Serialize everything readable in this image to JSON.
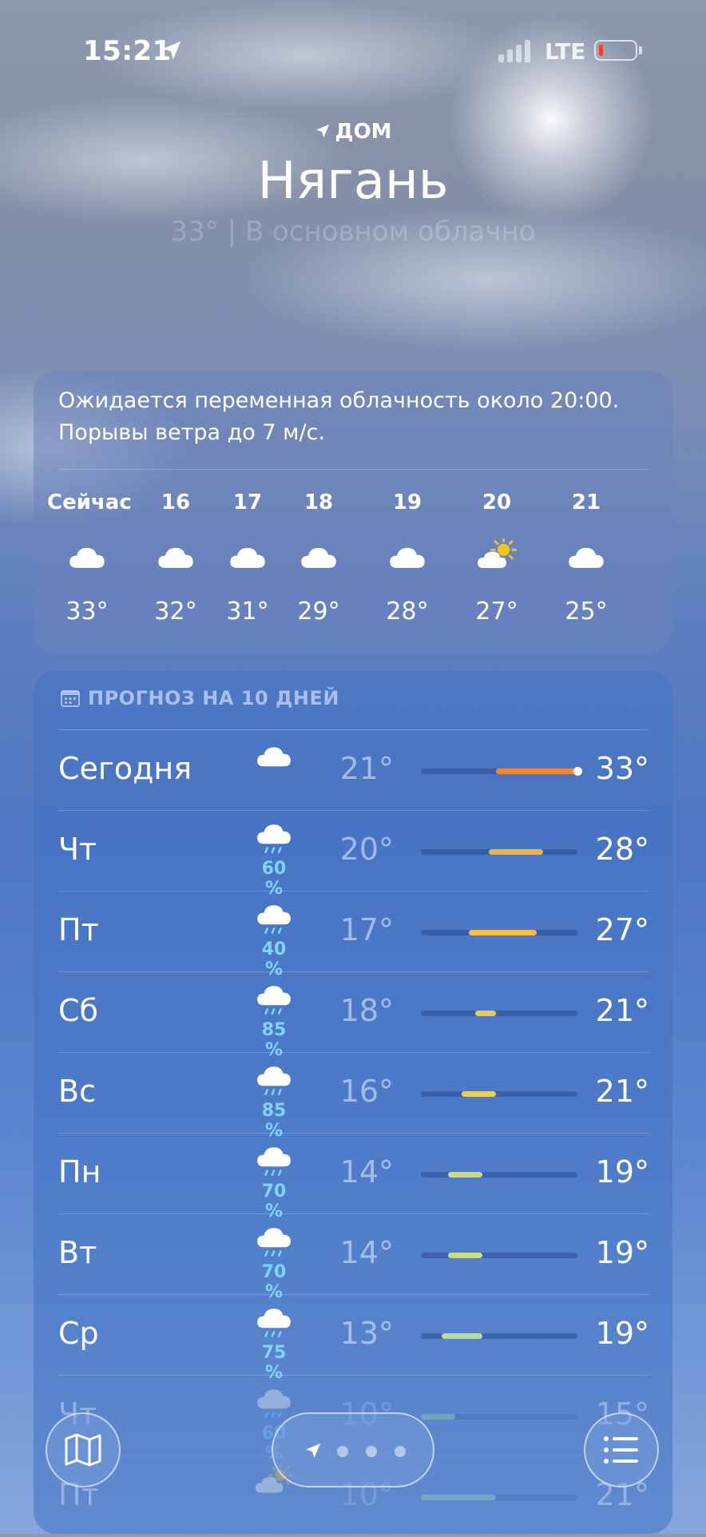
{
  "status_bar": {
    "time": "15:21",
    "network": "LTE"
  },
  "header": {
    "home_label": "ДОМ",
    "city": "Нягань",
    "subtitle": "33° | В основном облачно"
  },
  "hourly": {
    "summary": "Ожидается переменная облачность около 20:00. Порывы ветра до 7 м/с.",
    "hours": [
      {
        "label": "Сейчас",
        "icon": "cloud-icon",
        "temp": "33°"
      },
      {
        "label": "16",
        "icon": "cloud-icon",
        "temp": "32°"
      },
      {
        "label": "17",
        "icon": "cloud-icon",
        "temp": "31°"
      },
      {
        "label": "18",
        "icon": "cloud-icon",
        "temp": "29°"
      },
      {
        "label": "19",
        "icon": "cloud-icon",
        "temp": "28°"
      },
      {
        "label": "20",
        "icon": "sun-behind-cloud-icon",
        "temp": "27°"
      },
      {
        "label": "21",
        "icon": "cloud-icon",
        "temp": "25°"
      }
    ]
  },
  "daily": {
    "header": "ПРОГНОЗ НА 10 ДНЕЙ",
    "days": [
      {
        "day": "Сегодня",
        "icon": "cloud-icon",
        "precip": "",
        "low": "21°",
        "high": "33°",
        "low_value": 21,
        "high_value": 33,
        "current_value": 33,
        "bar_color": "#f0883a"
      },
      {
        "day": "Чт",
        "icon": "cloud-rain-icon",
        "precip": "60 %",
        "low": "20°",
        "high": "28°",
        "low_value": 20,
        "high_value": 28,
        "bar_color": "#f4b23c"
      },
      {
        "day": "Пт",
        "icon": "cloud-rain-icon",
        "precip": "40 %",
        "low": "17°",
        "high": "27°",
        "low_value": 17,
        "high_value": 27,
        "bar_color": "#f5c043"
      },
      {
        "day": "Сб",
        "icon": "cloud-rain-icon",
        "precip": "85 %",
        "low": "18°",
        "high": "21°",
        "low_value": 18,
        "high_value": 21,
        "bar_color": "#f0c850"
      },
      {
        "day": "Вс",
        "icon": "cloud-rain-icon",
        "precip": "85 %",
        "low": "16°",
        "high": "21°",
        "low_value": 16,
        "high_value": 21,
        "bar_color": "#e8d060"
      },
      {
        "day": "Пн",
        "icon": "cloud-rain-icon",
        "precip": "70 %",
        "low": "14°",
        "high": "19°",
        "low_value": 14,
        "high_value": 19,
        "bar_color": "#d2d878"
      },
      {
        "day": "Вт",
        "icon": "cloud-rain-icon",
        "precip": "70 %",
        "low": "14°",
        "high": "19°",
        "low_value": 14,
        "high_value": 19,
        "bar_color": "#c8dc8a"
      },
      {
        "day": "Ср",
        "icon": "cloud-rain-icon",
        "precip": "75 %",
        "low": "13°",
        "high": "19°",
        "low_value": 13,
        "high_value": 19,
        "bar_color": "#b8de98"
      },
      {
        "day": "Чт",
        "icon": "cloud-rain-icon",
        "precip": "60 %",
        "low": "10°",
        "high": "15°",
        "low_value": 10,
        "high_value": 15,
        "bar_color": "#a8dcb0"
      },
      {
        "day": "Пт",
        "icon": "sun-behind-cloud-icon",
        "precip": "",
        "low": "10°",
        "high": "21°",
        "low_value": 10,
        "high_value": 21,
        "bar_color": "#a8dcb0"
      }
    ]
  },
  "colors": {
    "precip": "#7ed3ff",
    "accent_bar": "#f0883a"
  }
}
